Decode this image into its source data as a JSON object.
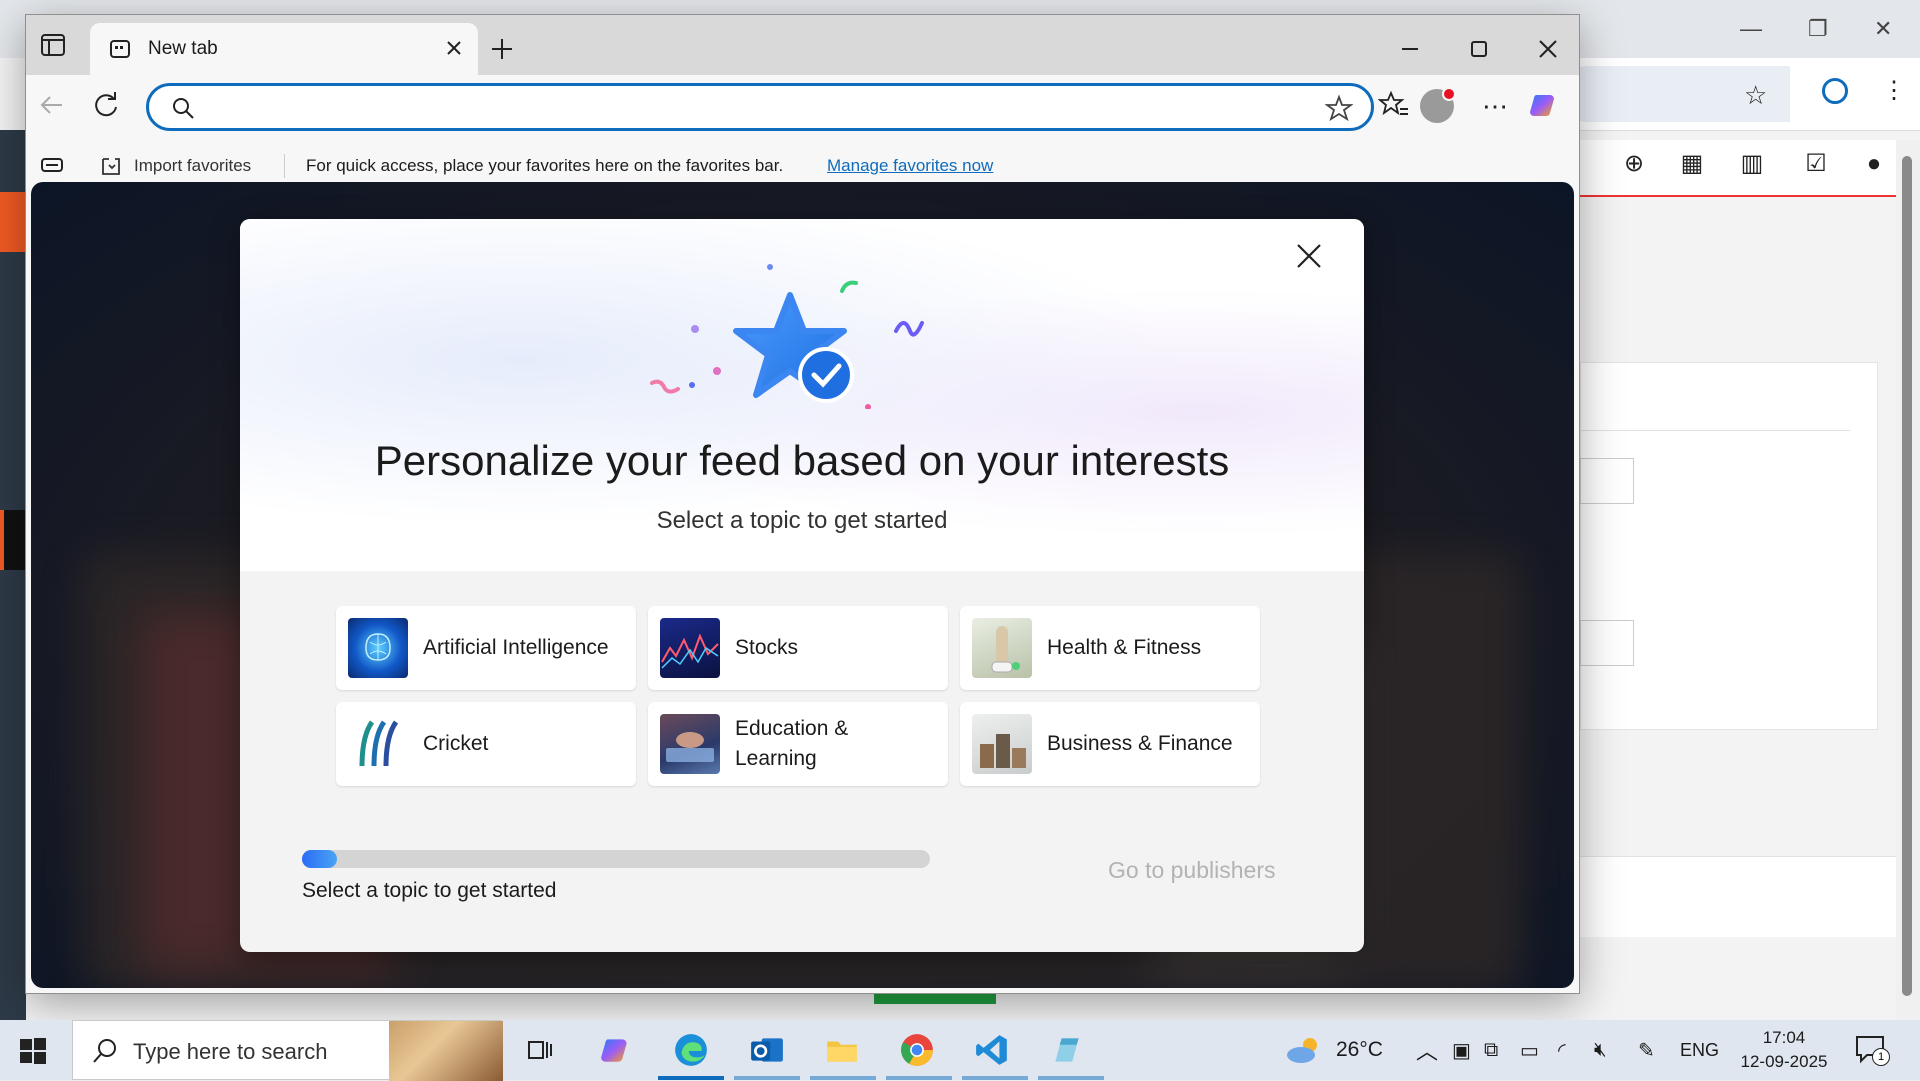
{
  "browser": {
    "tab_title": "New tab",
    "address_value": "",
    "favbar": {
      "import_label": "Import favorites",
      "hint": "For quick access, place your favorites here on the favorites bar.",
      "manage_link": "Manage favorites now"
    }
  },
  "dialog": {
    "headline": "Personalize your feed based on your interests",
    "subline": "Select a topic to get started",
    "topics": [
      {
        "label": "Artificial Intelligence",
        "thumb": "ai-brain-icon"
      },
      {
        "label": "Stocks",
        "thumb": "stocks-chart-icon"
      },
      {
        "label": "Health & Fitness",
        "thumb": "fitness-icon"
      },
      {
        "label": "Cricket",
        "thumb": "cricket-logo-icon"
      },
      {
        "label": "Education & Learning",
        "thumb": "education-icon"
      },
      {
        "label": "Business & Finance",
        "thumb": "coins-icon"
      }
    ],
    "progress_fraction": 0.055,
    "progress_label": "Select a topic to get started",
    "go_to_publishers": "Go to publishers"
  },
  "taskbar": {
    "search_placeholder": "Type here to search",
    "weather": "26°C",
    "language": "ENG",
    "time": "17:04",
    "date": "12-09-2025",
    "notification_count": "1"
  },
  "colors": {
    "accent": "#0f6cbd",
    "brand_orange": "#f15a24"
  }
}
